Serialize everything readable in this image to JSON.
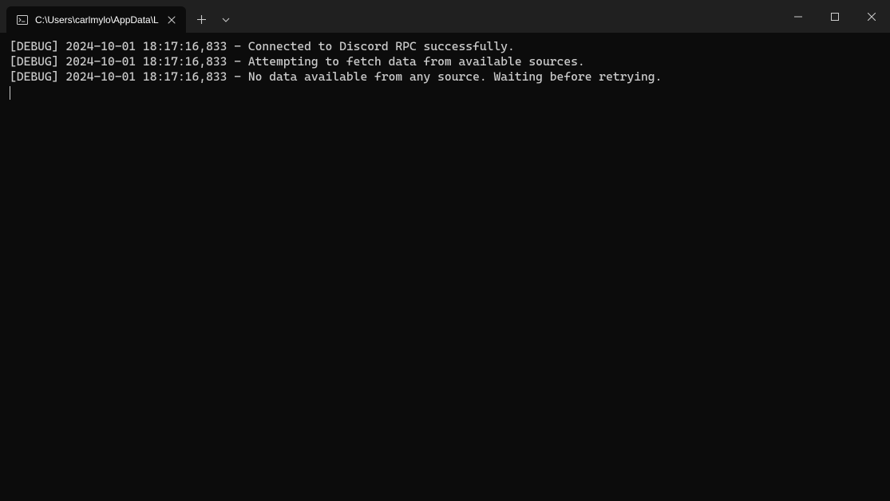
{
  "tab": {
    "title": "C:\\Users\\carlmylo\\AppData\\L"
  },
  "log_lines": [
    "[DEBUG] 2024-10-01 18:17:16,833 - Connected to Discord RPC successfully.",
    "[DEBUG] 2024-10-01 18:17:16,833 - Attempting to fetch data from available sources.",
    "[DEBUG] 2024-10-01 18:17:16,833 - No data available from any source. Waiting before retrying."
  ]
}
